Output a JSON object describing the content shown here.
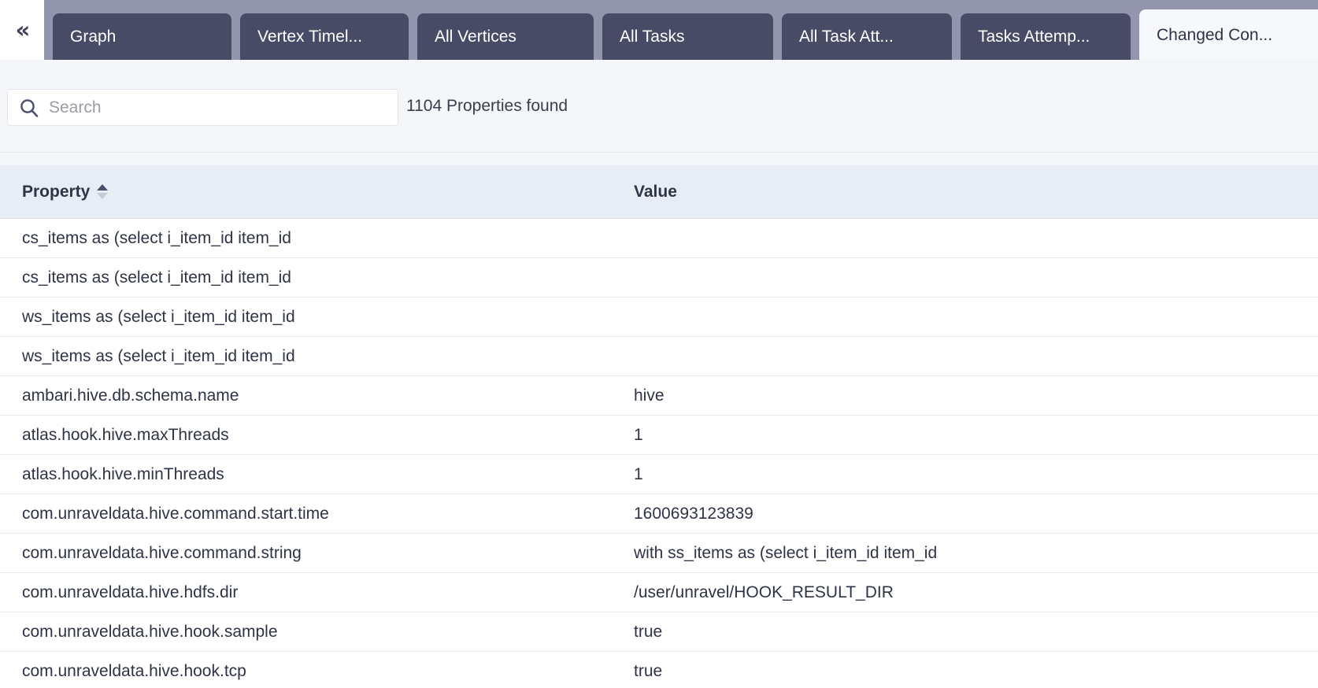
{
  "tabstrip": {
    "collapse_icon_label": "«",
    "tabs": [
      {
        "label": "Graph",
        "active": false
      },
      {
        "label": "Vertex Timel...",
        "active": false
      },
      {
        "label": "All Vertices",
        "active": false
      },
      {
        "label": "All Tasks",
        "active": false
      },
      {
        "label": "All Task Att...",
        "active": false
      },
      {
        "label": "Tasks Attemp...",
        "active": false
      },
      {
        "label": "Changed Con...",
        "active": true
      }
    ]
  },
  "search": {
    "placeholder": "Search",
    "value": "",
    "icon": "search-icon",
    "result_count_text": "1104 Properties found"
  },
  "table": {
    "columns": [
      {
        "key": "property",
        "label": "Property",
        "sortable": true,
        "sort_direction": "asc"
      },
      {
        "key": "value",
        "label": "Value",
        "sortable": false
      }
    ],
    "rows": [
      {
        "property": "cs_items as (select i_item_id item_id",
        "value": ""
      },
      {
        "property": "cs_items as (select i_item_id item_id",
        "value": ""
      },
      {
        "property": "ws_items as (select i_item_id item_id",
        "value": ""
      },
      {
        "property": "ws_items as (select i_item_id item_id",
        "value": ""
      },
      {
        "property": "ambari.hive.db.schema.name",
        "value": "hive"
      },
      {
        "property": "atlas.hook.hive.maxThreads",
        "value": "1"
      },
      {
        "property": "atlas.hook.hive.minThreads",
        "value": "1"
      },
      {
        "property": "com.unraveldata.hive.command.start.time",
        "value": "1600693123839"
      },
      {
        "property": "com.unraveldata.hive.command.string",
        "value": "with ss_items as (select i_item_id item_id"
      },
      {
        "property": "com.unraveldata.hive.hdfs.dir",
        "value": "/user/unravel/HOOK_RESULT_DIR"
      },
      {
        "property": "com.unraveldata.hive.hook.sample",
        "value": "true"
      },
      {
        "property": "com.unraveldata.hive.hook.tcp",
        "value": "true"
      }
    ]
  },
  "colors": {
    "tabstrip_background": "#9295ac",
    "tab_inactive": "#474b66",
    "tab_active": "#f7f8fb",
    "page_background": "#f5f6fa",
    "table_header": "#e8ecf4",
    "text_primary": "#2f3346"
  }
}
